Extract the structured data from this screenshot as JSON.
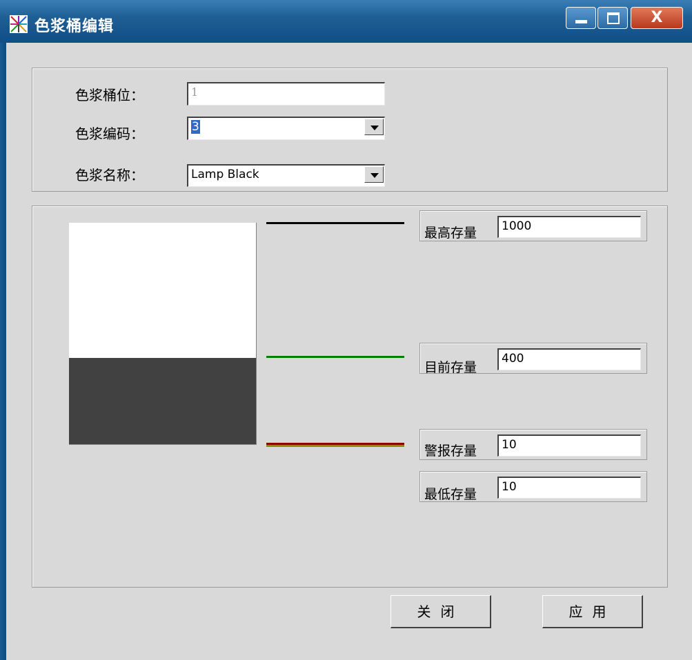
{
  "window": {
    "title": "色浆桶编辑",
    "close_glyph": "X"
  },
  "form": {
    "bucket_position_label": "色浆桶位：",
    "bucket_position_value": "1",
    "color_code_label": "色浆编码：",
    "color_code_value": "3",
    "color_name_label": "色浆名称：",
    "color_name_value": "Lamp Black"
  },
  "levels": {
    "max_label": "最高存量",
    "max_value": "1000",
    "current_label": "目前存量",
    "current_value": "400",
    "alarm_label": "警报存量",
    "alarm_value": "10",
    "min_label": "最低存量",
    "min_value": "10",
    "tank_fill_fraction": 0.39
  },
  "colors": {
    "max_line": "#000000",
    "current_line": "#008000",
    "alarm_line_top": "#8b0000",
    "alarm_line_bottom": "#8b8b00",
    "tank_fill": "#414141"
  },
  "buttons": {
    "close_label": "关闭",
    "apply_label": "应用"
  },
  "icons": {
    "app": "color-palette-icon",
    "minimize": "minimize-icon",
    "maximize": "maximize-icon",
    "close": "close-icon",
    "dropdown": "chevron-down-icon"
  }
}
